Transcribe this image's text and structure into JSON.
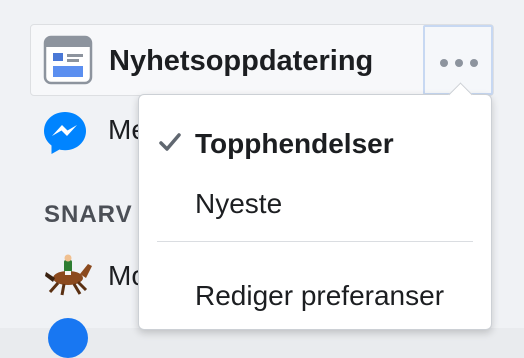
{
  "nav": {
    "title": "Nyhetsoppdatering",
    "more_icon": "more-dots-icon",
    "icon": "news-feed-icon"
  },
  "sidebar": {
    "messenger_label": "Me",
    "messenger_icon": "messenger-icon",
    "section_heading": "SNARV",
    "shortcut_label": "Mo",
    "shortcut_icon": "horse-rider-icon"
  },
  "dropdown": {
    "items": [
      {
        "label": "Topphendelser",
        "selected": true
      },
      {
        "label": "Nyeste",
        "selected": false
      },
      {
        "label": "Rediger preferanser",
        "selected": false
      }
    ]
  },
  "colors": {
    "brand_blue": "#1877f2",
    "messenger_blue": "#0084ff",
    "text": "#1c1e21",
    "muted": "#8d949e"
  }
}
